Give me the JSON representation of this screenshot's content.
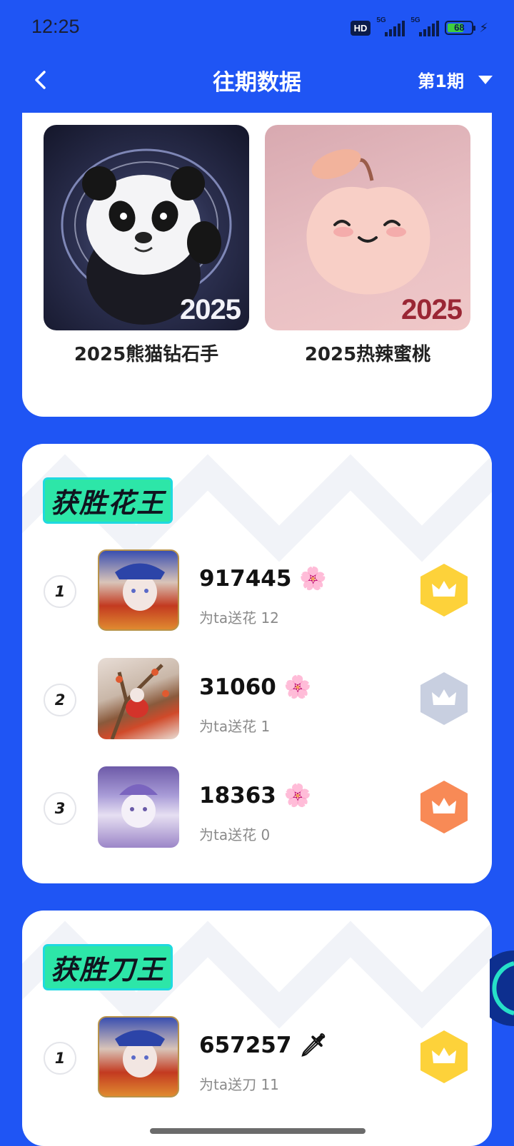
{
  "status_bar": {
    "time": "12:25",
    "hd_label": "HD",
    "signal1": "5G",
    "signal2": "5G",
    "battery": "68"
  },
  "nav": {
    "title": "往期数据",
    "period": "第1期"
  },
  "collection": {
    "items": [
      {
        "name": "2025熊猫钻石手",
        "year": "2025"
      },
      {
        "name": "2025热辣蜜桃",
        "year": "2025"
      }
    ]
  },
  "flower_board": {
    "title": "获胜花王",
    "rows": [
      {
        "rank": "1",
        "score": "917445",
        "sub": "为ta送花 12",
        "medal": "gold"
      },
      {
        "rank": "2",
        "score": "31060",
        "sub": "为ta送花 1",
        "medal": "silver"
      },
      {
        "rank": "3",
        "score": "18363",
        "sub": "为ta送花 0",
        "medal": "bronze"
      }
    ]
  },
  "knife_board": {
    "title": "获胜刀王",
    "rows": [
      {
        "rank": "1",
        "score": "657257",
        "sub": "为ta送刀 11",
        "medal": "gold"
      }
    ]
  },
  "colors": {
    "background": "#1f55f4",
    "gold": "#fdd23a",
    "silver": "#c8cfe0",
    "bronze": "#f88a56",
    "badge": "#2de6a8"
  }
}
